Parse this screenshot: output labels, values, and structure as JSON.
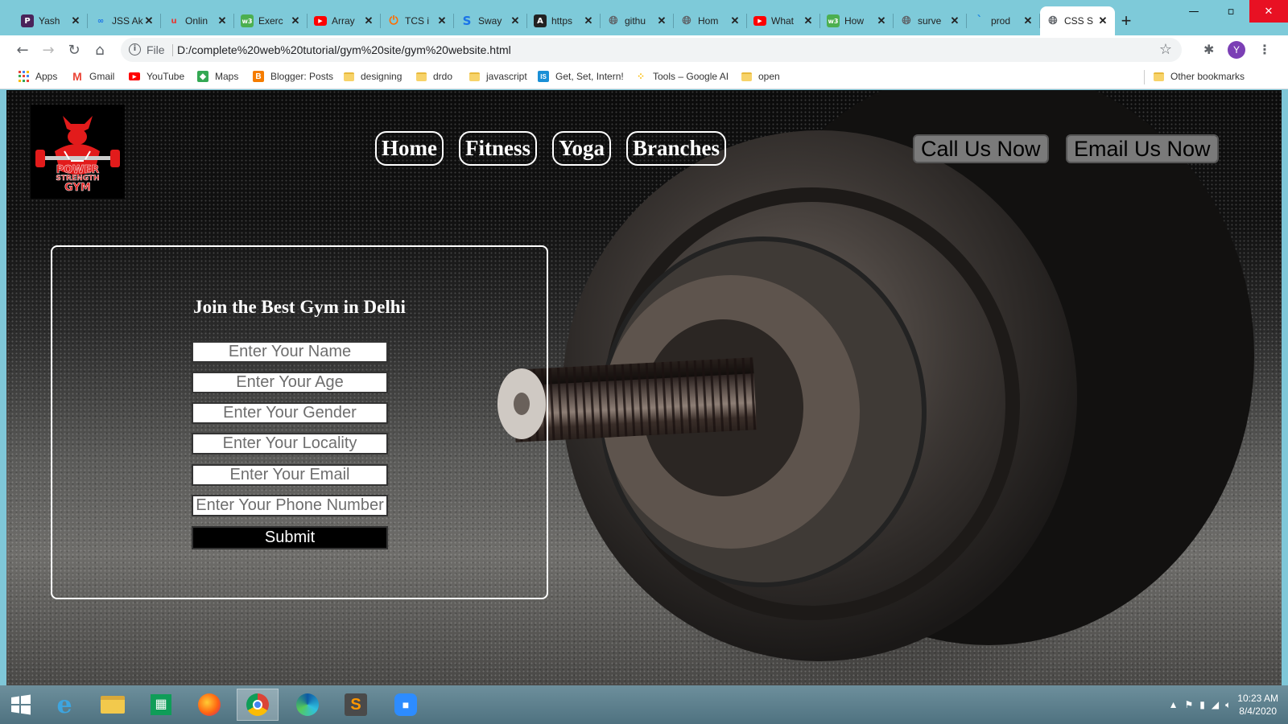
{
  "browser": {
    "tabs": [
      {
        "title": "Yash",
        "icon": "p-icon",
        "color": "#4a235a"
      },
      {
        "title": "JSS Ak",
        "icon": "link-icon",
        "color": "#1a73e8"
      },
      {
        "title": "Onlin",
        "icon": "u-icon",
        "color": "#e53935"
      },
      {
        "title": "Exerc",
        "icon": "w3-icon",
        "color": "#4caf50"
      },
      {
        "title": "Array",
        "icon": "youtube-icon",
        "color": "#ff0000"
      },
      {
        "title": "TCS i",
        "icon": "power-icon",
        "color": "#ff6d00"
      },
      {
        "title": "Sway",
        "icon": "s-icon",
        "color": "#1a73e8"
      },
      {
        "title": "https",
        "icon": "a-icon",
        "color": "#222"
      },
      {
        "title": "githu",
        "icon": "globe-icon",
        "color": "#5f6368"
      },
      {
        "title": "Hom",
        "icon": "globe-icon",
        "color": "#5f6368"
      },
      {
        "title": "What",
        "icon": "youtube-icon",
        "color": "#ff0000"
      },
      {
        "title": "How",
        "icon": "w3-icon",
        "color": "#4caf50"
      },
      {
        "title": "surve",
        "icon": "globe-icon",
        "color": "#5f6368"
      },
      {
        "title": "prod",
        "icon": "tick-icon",
        "color": "#1e88e5"
      },
      {
        "title": "CSS S",
        "icon": "globe-icon",
        "color": "#5f6368"
      }
    ],
    "active_tab": 14,
    "new_tab": "+",
    "address": {
      "scheme": "File",
      "url": "D:/complete%20web%20tutorial/gym%20site/gym%20website.html"
    },
    "profile_initial": "Y",
    "bookmarks": [
      {
        "label": "Apps",
        "icon": "apps-grid-icon"
      },
      {
        "label": "Gmail",
        "icon": "gmail-icon",
        "color": "#ea4335"
      },
      {
        "label": "YouTube",
        "icon": "youtube-icon",
        "color": "#ff0000"
      },
      {
        "label": "Maps",
        "icon": "maps-icon",
        "color": "#34a853"
      },
      {
        "label": "Blogger: Posts",
        "icon": "blogger-icon",
        "color": "#f57c00"
      },
      {
        "label": "designing",
        "icon": "folder-icon"
      },
      {
        "label": "drdo",
        "icon": "folder-icon"
      },
      {
        "label": "javascript",
        "icon": "folder-icon"
      },
      {
        "label": "Get, Set, Intern!",
        "icon": "is-icon",
        "color": "#1a8fd6"
      },
      {
        "label": "Tools – Google AI",
        "icon": "ai-dots-icon",
        "color": "#fbbc04"
      },
      {
        "label": "open",
        "icon": "folder-icon"
      }
    ],
    "other_bookmarks": "Other bookmarks"
  },
  "page": {
    "logo_text": [
      "POWER",
      "STRENGTH",
      "GYM"
    ],
    "nav": [
      "Home",
      "Fitness",
      "Yoga",
      "Branches"
    ],
    "cta": [
      "Call Us Now",
      "Email Us Now"
    ],
    "form": {
      "title": "Join the Best Gym in Delhi",
      "fields": [
        "Enter Your Name",
        "Enter Your Age",
        "Enter Your Gender",
        "Enter Your Locality",
        "Enter Your Email",
        "Enter Your Phone Number"
      ],
      "submit": "Submit"
    }
  },
  "taskbar": {
    "apps": [
      "windows-start-icon",
      "internet-explorer-icon",
      "file-explorer-icon",
      "store-icon",
      "firefox-icon",
      "chrome-icon",
      "edge-icon",
      "sublime-text-icon",
      "zoom-icon"
    ],
    "active_app": "chrome-icon",
    "time": "10:23 AM",
    "date": "8/4/2020"
  }
}
